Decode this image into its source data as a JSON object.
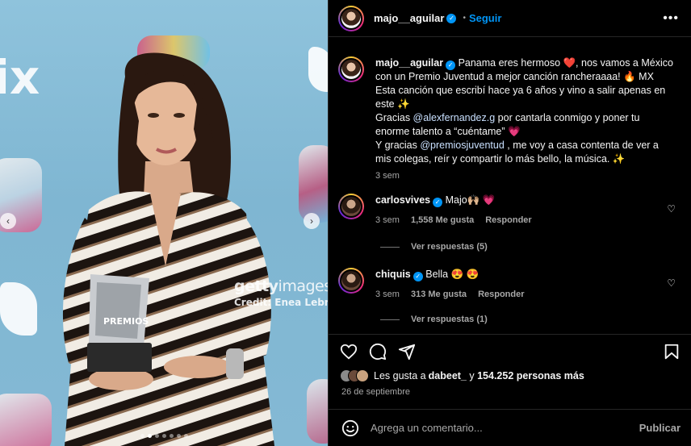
{
  "media": {
    "backdrop_text": "ix",
    "watermark_brand": "getty",
    "watermark_brand2": "images",
    "watermark_credit": "Credit: Enea Lebr",
    "trophy_text": "PREMIOS",
    "prev_icon": "chevron-left-icon",
    "next_icon": "chevron-right-icon",
    "dot_count": 7,
    "active_dot": 1
  },
  "header": {
    "username": "majo__aguilar",
    "separator": "•",
    "follow_label": "Seguir",
    "more_icon": "more-horizontal-icon"
  },
  "caption": {
    "username": "majo__aguilar",
    "line1": "Panama eres hermoso ❤️, nos vamos a México con un Premio Juventud a mejor canción rancheraaaa! 🔥 MX",
    "line2": "Esta canción que escribí hace ya 6 años y vino a salir apenas en este ✨",
    "line3_pre": "Gracias ",
    "line3_mention": "@alexfernandez.g",
    "line3_post": " por cantarla conmigo y poner tu enorme talento a “cuéntame” 💗",
    "line4_pre": "Y gracias ",
    "line4_mention": "@premiosjuventud",
    "line4_post": " , me voy a casa contenta de ver a mis colegas, reír y compartir lo más bello, la música. ✨",
    "time": "3 sem"
  },
  "comments": [
    {
      "username": "carlosvives",
      "text": "Majo🙌🏼 💗",
      "time": "3 sem",
      "likes": "1,558 Me gusta",
      "reply": "Responder",
      "view_replies": "Ver respuestas (5)"
    },
    {
      "username": "chiquis",
      "text": "Bella 😍 😍",
      "time": "3 sem",
      "likes": "313 Me gusta",
      "reply": "Responder",
      "view_replies": "Ver respuestas (1)"
    }
  ],
  "actions": {
    "like_icon": "heart-icon",
    "comment_icon": "comment-icon",
    "share_icon": "share-icon",
    "save_icon": "bookmark-icon"
  },
  "likes": {
    "prefix": "Les gusta a ",
    "user": "dabeet_",
    "middle": " y ",
    "count": "154.252 personas más"
  },
  "date": "26 de septiembre",
  "add_comment": {
    "placeholder": "Agrega un comentario...",
    "publish_label": "Publicar",
    "emoji_icon": "emoji-icon"
  },
  "colors": {
    "accent": "#0095f6",
    "background": "#000000",
    "secondary_text": "#a8a8a8"
  }
}
